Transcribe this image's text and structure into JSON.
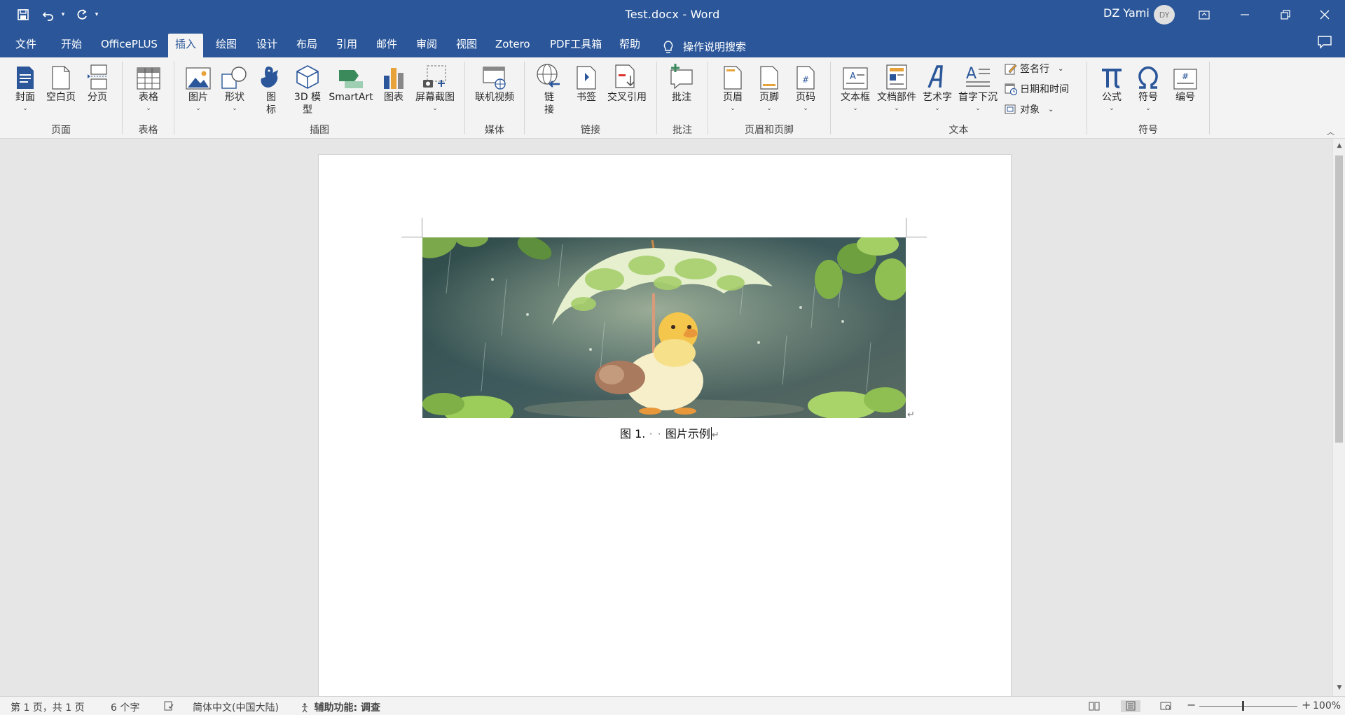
{
  "window": {
    "title": "Test.docx  -  Word",
    "user": "DZ Yami",
    "avatar_initials": "DY"
  },
  "tabs": [
    "文件",
    "开始",
    "OfficePLUS",
    "插入",
    "绘图",
    "设计",
    "布局",
    "引用",
    "邮件",
    "审阅",
    "视图",
    "Zotero",
    "PDF工具箱",
    "帮助"
  ],
  "active_tab": "插入",
  "tell_me": "操作说明搜索",
  "ribbon": {
    "groups": {
      "pages": "页面",
      "tables": "表格",
      "illustrations": "插图",
      "media": "媒体",
      "links": "链接",
      "comments": "批注",
      "header_footer": "页眉和页脚",
      "text": "文本",
      "symbols": "符号"
    },
    "buttons": {
      "cover": "封面",
      "blank_page": "空白页",
      "page_break": "分页",
      "table": "表格",
      "picture": "图片",
      "shapes": "形状",
      "icons": "图\n标",
      "model3d": "3D 模\n型",
      "smartart": "SmartArt",
      "chart": "图表",
      "screenshot": "屏幕截图",
      "online_video": "联机视频",
      "link": "链\n接",
      "bookmark": "书签",
      "cross_ref": "交叉引用",
      "comment": "批注",
      "header": "页眉",
      "footer": "页脚",
      "page_number": "页码",
      "textbox": "文本框",
      "quick_parts": "文档部件",
      "wordart": "艺术字",
      "dropcap": "首字下沉",
      "signature_line": "签名行",
      "date_time": "日期和时间",
      "object": "对象",
      "equation": "公式",
      "symbol": "符号",
      "numbering": "编号"
    }
  },
  "document": {
    "caption_prefix": "图 1.",
    "caption_dots": "· ·",
    "caption_text": "图片示例"
  },
  "status": {
    "page": "第 1 页，共 1 页",
    "words": "6 个字",
    "language": "简体中文(中国大陆)",
    "accessibility": "辅助功能: 调查",
    "zoom": "100%"
  },
  "colors": {
    "brand": "#2b579a",
    "ribbon_bg": "#f3f3f3",
    "canvas_bg": "#e6e6e6"
  }
}
